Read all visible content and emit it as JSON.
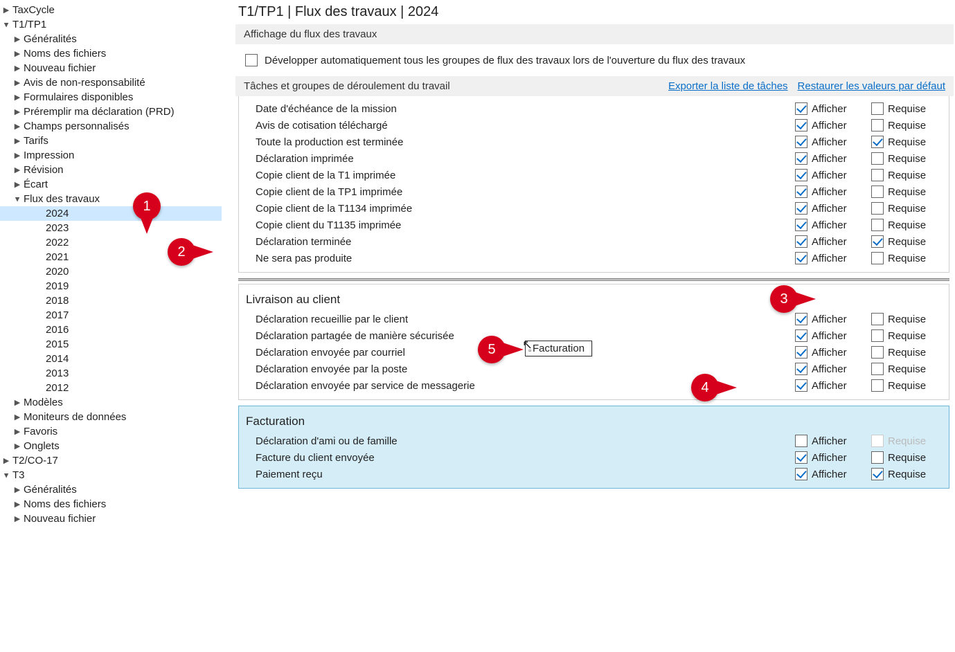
{
  "sidebar": {
    "root0": "TaxCycle",
    "root1": "T1/TP1",
    "items1": [
      "Généralités",
      "Noms des fichiers",
      "Nouveau fichier",
      "Avis de non-responsabilité",
      "Formulaires disponibles",
      "Préremplir ma déclaration (PRD)",
      "Champs personnalisés",
      "Tarifs",
      "Impression",
      "Révision",
      "Écart"
    ],
    "flux": "Flux des travaux",
    "years": [
      "2024",
      "2023",
      "2022",
      "2021",
      "2020",
      "2019",
      "2018",
      "2017",
      "2016",
      "2015",
      "2014",
      "2013",
      "2012"
    ],
    "items2": [
      "Modèles",
      "Moniteurs de données",
      "Favoris",
      "Onglets"
    ],
    "root2": "T2/CO-17",
    "root3": "T3",
    "items3": [
      "Généralités",
      "Noms des fichiers",
      "Nouveau fichier"
    ]
  },
  "main": {
    "title": "T1/TP1 | Flux des travaux | 2024",
    "section1": "Affichage du flux des travaux",
    "expand_label": "Développer automatiquement tous les groupes de flux des travaux lors de l'ouverture du flux des travaux",
    "tasks_label": "Tâches et groupes de déroulement du travail",
    "export_link": "Exporter la liste de tâches",
    "restore_link": "Restaurer les valeurs par défaut",
    "col_show": "Afficher",
    "col_req": "Requise",
    "groupA": {
      "rows": [
        {
          "label": "Date d'échéance de la mission",
          "show": true,
          "req": false
        },
        {
          "label": "Avis de cotisation téléchargé",
          "show": true,
          "req": false
        },
        {
          "label": "Toute la production est terminée",
          "show": true,
          "req": true
        },
        {
          "label": "Déclaration imprimée",
          "show": true,
          "req": false
        },
        {
          "label": "Copie client de la T1 imprimée",
          "show": true,
          "req": false
        },
        {
          "label": "Copie client de la TP1 imprimée",
          "show": true,
          "req": false
        },
        {
          "label": "Copie client de la T1134 imprimée",
          "show": true,
          "req": false
        },
        {
          "label": "Copie client du T1135 imprimée",
          "show": true,
          "req": false
        },
        {
          "label": "Déclaration terminée",
          "show": true,
          "req": true
        },
        {
          "label": "Ne sera pas produite",
          "show": true,
          "req": false
        }
      ]
    },
    "groupB": {
      "title": "Livraison au client",
      "rows": [
        {
          "label": "Déclaration recueillie par le client",
          "show": true,
          "req": false
        },
        {
          "label": "Déclaration partagée de manière sécurisée",
          "show": true,
          "req": false
        },
        {
          "label": "Déclaration envoyée par courriel",
          "show": true,
          "req": false
        },
        {
          "label": "Déclaration envoyée par la poste",
          "show": true,
          "req": false
        },
        {
          "label": "Déclaration envoyée par service de messagerie",
          "show": true,
          "req": false
        }
      ]
    },
    "groupC": {
      "title": "Facturation",
      "rows": [
        {
          "label": "Déclaration d'ami ou de famille",
          "show": false,
          "req": false,
          "req_disabled": true
        },
        {
          "label": "Facture du client envoyée",
          "show": true,
          "req": false
        },
        {
          "label": "Paiement reçu",
          "show": true,
          "req": true
        }
      ]
    },
    "drag_tip": "Facturation"
  },
  "callouts": {
    "c1": "1",
    "c2": "2",
    "c3": "3",
    "c4": "4",
    "c5": "5"
  }
}
